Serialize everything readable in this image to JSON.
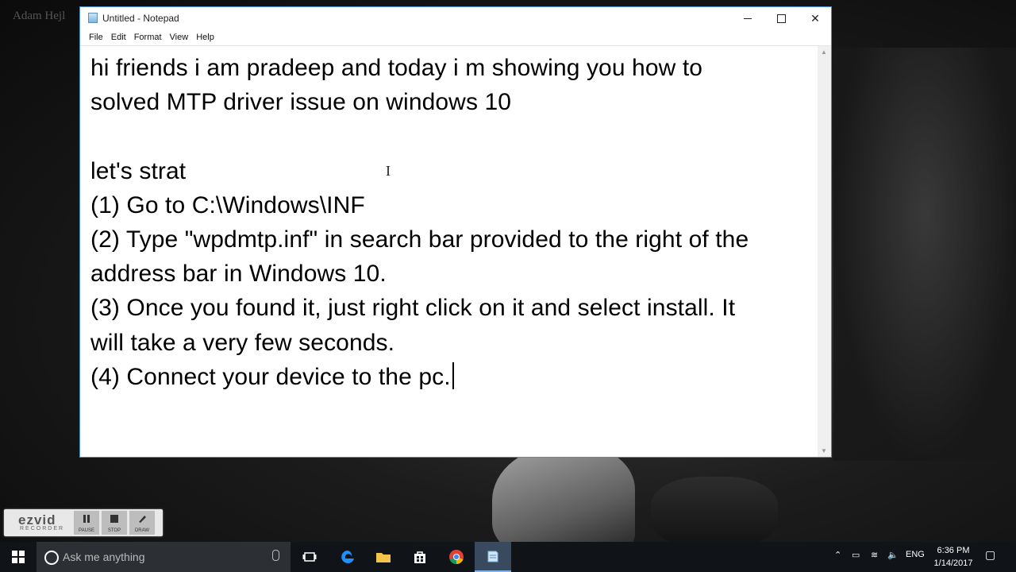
{
  "desktop": {
    "corner_text": "Adam Hejl"
  },
  "window": {
    "title": "Untitled - Notepad",
    "controls": {
      "minimize": "—",
      "maximize": "□",
      "close": "✕"
    },
    "menu": [
      "File",
      "Edit",
      "Format",
      "View",
      "Help"
    ]
  },
  "editor": {
    "lines": [
      "hi friends i am pradeep and today i m showing you how to",
      "solved MTP driver issue on windows 10",
      "",
      "let's strat",
      "(1) Go to C:\\Windows\\INF",
      "(2) Type \"wpdmtp.inf\" in search bar provided to the right of the",
      "address bar in Windows 10.",
      "(3) Once you found it, just right click on it and select install. It",
      "will take a very few seconds.",
      "(4) Connect your device to the pc."
    ]
  },
  "ezvid": {
    "logo": "ezvid",
    "subtitle": "RECORDER",
    "buttons": [
      "PAUSE",
      "STOP",
      "DRAW"
    ]
  },
  "taskbar": {
    "search_placeholder": "Ask me anything",
    "tray_language": "ENG",
    "time": "6:36 PM",
    "date": "1/14/2017"
  }
}
